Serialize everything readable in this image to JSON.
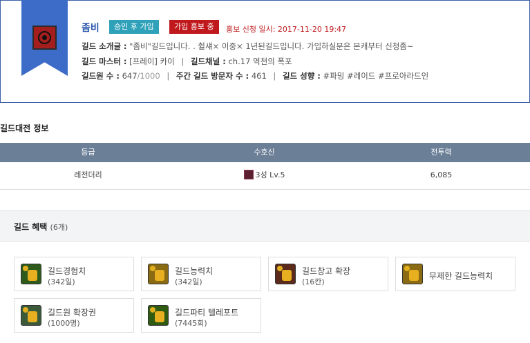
{
  "guild": {
    "name": "좀비",
    "badge_approve": "승인 후 가입",
    "badge_recruit": "가입 홍보 중",
    "apply_label": "홍보 신청 일시:",
    "apply_date": "2017-11-20 19:47",
    "intro_key": "길드 소개글 :",
    "intro_val": "\"좀비\"길드입니다. . 췰섀× 이중× 1년된길드입니다. 가입하실분은 본캐부터 신청좀~",
    "master_key": "길드 마스터 :",
    "master_val": "[프레이] 카이",
    "channel_key": "길드채널 :",
    "channel_val": "ch.17 역천의 폭포",
    "members_key": "길드원 수 :",
    "members_val": "647",
    "members_max": "/1000",
    "visitors_key": "주간 길드 방문자 수 :",
    "visitors_val": "461",
    "tendency_key": "길드 성향 :",
    "tendency_val": "#파밍 #레이드 #프로아라드인",
    "sep": "|"
  },
  "battle": {
    "title": "길드대전 정보",
    "headers": [
      "등급",
      "수호신",
      "전투력"
    ],
    "row": {
      "grade": "레전더리",
      "guardian": "3성 Lv.5",
      "power": "6,085"
    }
  },
  "benefits": {
    "title": "길드 혜택",
    "count": "(6개)",
    "items": [
      {
        "name": "길드경험치",
        "detail": "(342일)",
        "icon": "exp-icon"
      },
      {
        "name": "길드능력치",
        "detail": "(342일)",
        "icon": "ability-icon"
      },
      {
        "name": "길드창고 확장",
        "detail": "(16칸)",
        "icon": "storage-icon"
      },
      {
        "name": "무제한 길드능력치",
        "detail": "",
        "icon": "unlimited-ability-icon"
      },
      {
        "name": "길드원 확장권",
        "detail": "(1000명)",
        "icon": "member-expand-icon"
      },
      {
        "name": "길드파티 텔레포트",
        "detail": "(7445회)",
        "icon": "teleport-icon"
      }
    ]
  },
  "colors": {
    "brand_blue": "#3d6cc8",
    "header_gray": "#6b7f97",
    "badge_teal": "#2fa1b9",
    "badge_red": "#c0191d"
  }
}
